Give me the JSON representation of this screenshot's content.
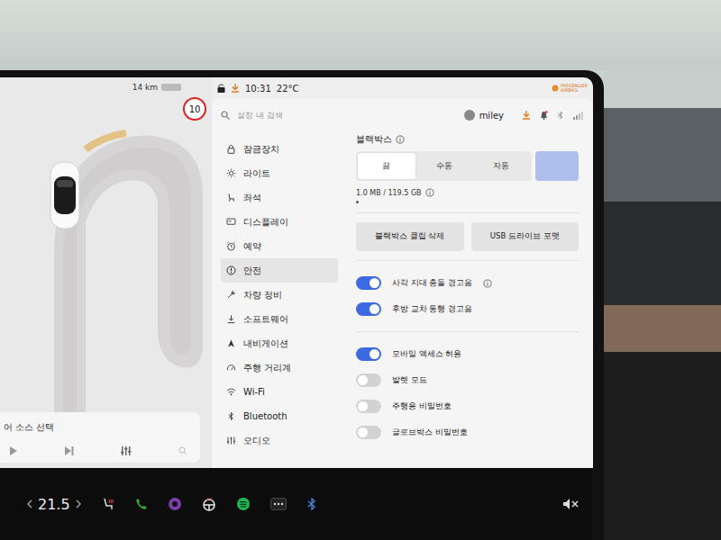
{
  "map": {
    "range": "14 km",
    "speed_limit": "10",
    "media_source": "어 소스 선택"
  },
  "status": {
    "time": "10:31",
    "temperature": "22°C",
    "airbag": "PASSENGER AIRBAG"
  },
  "search": {
    "placeholder": "설정 내 검색"
  },
  "user": {
    "name": "miley"
  },
  "sidebar": {
    "items": [
      {
        "label": "잠금장치",
        "selected": false
      },
      {
        "label": "라이트",
        "selected": false
      },
      {
        "label": "좌석",
        "selected": false
      },
      {
        "label": "디스플레이",
        "selected": false
      },
      {
        "label": "예약",
        "selected": false
      },
      {
        "label": "안전",
        "selected": true
      },
      {
        "label": "차량 정비",
        "selected": false
      },
      {
        "label": "소프트웨어",
        "selected": false
      },
      {
        "label": "내비게이션",
        "selected": false
      },
      {
        "label": "주행 거리계",
        "selected": false
      },
      {
        "label": "Wi-Fi",
        "selected": false
      },
      {
        "label": "Bluetooth",
        "selected": false
      },
      {
        "label": "오디오",
        "selected": false
      }
    ]
  },
  "dashcam": {
    "title": "블랙박스",
    "options": [
      {
        "label": "끔",
        "selected": true
      },
      {
        "label": "수동",
        "selected": false
      },
      {
        "label": "자동",
        "selected": false
      }
    ],
    "storage": "1.0 MB / 119.5 GB",
    "level": 0.01,
    "buttons": [
      "블랙박스 클립 삭제",
      "USB 드라이브 포맷"
    ]
  },
  "alerts": [
    {
      "label": "사각 지대 충돌 경고음",
      "on": true,
      "info": true
    },
    {
      "label": "후방 교차 통행 경고음",
      "on": true,
      "info": false
    }
  ],
  "access": [
    {
      "label": "모바일 액세스 허용",
      "on": true,
      "info": false
    },
    {
      "label": "발렛 모드",
      "on": false,
      "info": false
    },
    {
      "label": "주행용 비밀번호",
      "on": false,
      "info": false
    },
    {
      "label": "글로브박스 비밀번호",
      "on": false,
      "info": false
    }
  ],
  "taskbar": {
    "temperature": "21.5"
  }
}
